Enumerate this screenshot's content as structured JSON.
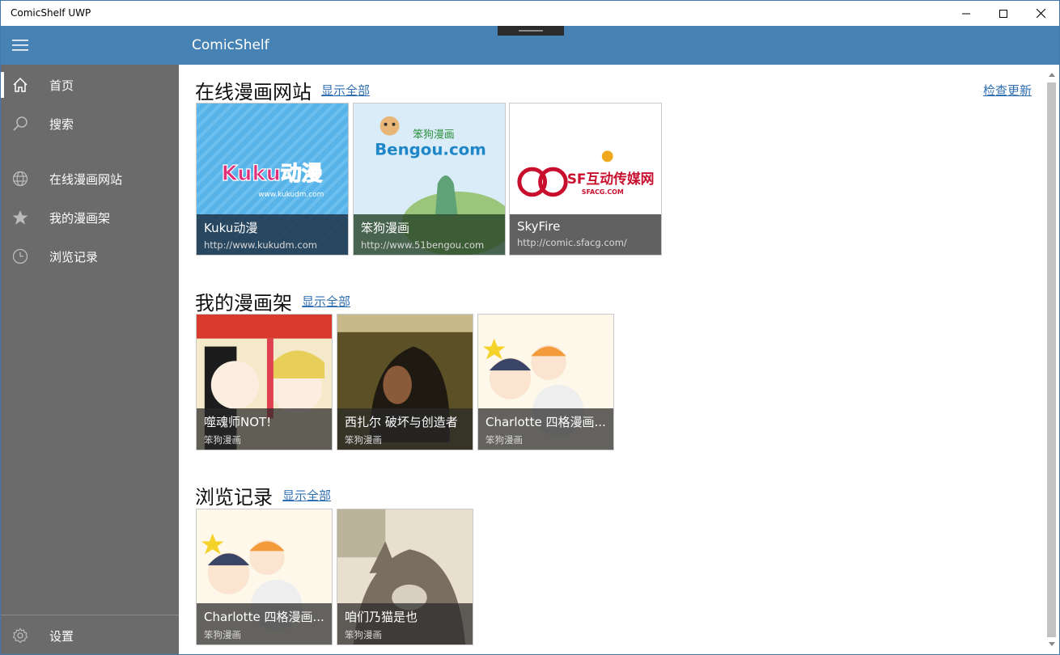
{
  "window": {
    "title": "ComicShelf UWP"
  },
  "appbar": {
    "title": "ComicShelf"
  },
  "sidebar": {
    "items": [
      {
        "label": "首页",
        "icon": "home-icon",
        "active": true
      },
      {
        "label": "搜索",
        "icon": "search-icon",
        "active": false
      },
      {
        "label": "在线漫画网站",
        "icon": "globe-icon",
        "active": false
      },
      {
        "label": "我的漫画架",
        "icon": "star-icon",
        "active": false
      },
      {
        "label": "浏览记录",
        "icon": "clock-icon",
        "active": false
      }
    ],
    "settings_label": "设置"
  },
  "main": {
    "check_update_label": "检查更新",
    "sites": {
      "title": "在线漫画网站",
      "show_all": "显示全部",
      "items": [
        {
          "title": "Kuku动漫",
          "url": "http://www.kukudm.com",
          "logo_text": "Kuku动漫",
          "logo_sub": "www.kukudm.com"
        },
        {
          "title": "笨狗漫画",
          "url": "http://www.51bengou.com",
          "logo_text": "Bengou.com",
          "logo_sub": "笨狗漫画"
        },
        {
          "title": "SkyFire",
          "url": "http://comic.sfacg.com/",
          "logo_text": "SF互动传媒网",
          "logo_sub": "SFACG.COM"
        }
      ]
    },
    "shelf": {
      "title": "我的漫画架",
      "show_all": "显示全部",
      "items": [
        {
          "title": "噬魂师NOT!",
          "source": "笨狗漫画"
        },
        {
          "title": "西扎尔 破坏与创造者",
          "source": "笨狗漫画"
        },
        {
          "title": "Charlotte 四格漫画...",
          "source": "笨狗漫画"
        }
      ]
    },
    "history": {
      "title": "浏览记录",
      "show_all": "显示全部",
      "items": [
        {
          "title": "Charlotte 四格漫画...",
          "source": "笨狗漫画"
        },
        {
          "title": "咱们乃猫是也",
          "source": "笨狗漫画"
        }
      ]
    }
  },
  "colors": {
    "accent": "#4682b4",
    "sidebar": "#6b6b6b",
    "link": "#2f6fb1"
  }
}
